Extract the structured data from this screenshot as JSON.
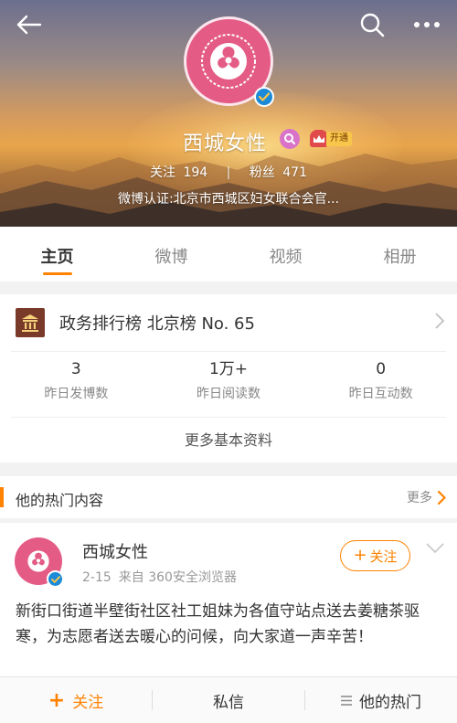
{
  "header": {
    "profile_name": "西城女性",
    "member_tag": "开通",
    "follow_label": "关注",
    "follow_count": "194",
    "fans_label": "粉丝",
    "fans_count": "471",
    "verification": "微博认证:北京市西城区妇女联合会官..."
  },
  "tabs": [
    {
      "label": "主页",
      "active": true
    },
    {
      "label": "微博",
      "active": false
    },
    {
      "label": "视频",
      "active": false
    },
    {
      "label": "相册",
      "active": false
    }
  ],
  "rank": {
    "text": "政务排行榜 北京榜 No. 65"
  },
  "metrics": [
    {
      "value": "3",
      "label": "昨日发博数"
    },
    {
      "value": "1万+",
      "label": "昨日阅读数"
    },
    {
      "value": "0",
      "label": "昨日互动数"
    }
  ],
  "more_info_label": "更多基本资料",
  "hot": {
    "title": "他的热门内容",
    "more_label": "更多"
  },
  "post": {
    "author": "西城女性",
    "date": "2-15",
    "source": "来自 360安全浏览器",
    "follow_label": "关注",
    "text": "新街口街道半壁街社区社工姐妹为各值守站点送去姜糖茶驱寒，为志愿者送去暖心的问候，向大家道一声辛苦！"
  },
  "bottom_bar": {
    "follow_label": "关注",
    "message_label": "私信",
    "hot_label": "他的热门"
  },
  "colors": {
    "accent": "#ff8200",
    "verified": "#1b8ad8",
    "avatar": "#e45b86"
  },
  "icons": [
    "back-arrow-icon",
    "search-icon",
    "more-icon",
    "verified-icon",
    "vip-icon",
    "crown-icon",
    "government-building-icon",
    "chevron-right-icon",
    "chevron-down-icon",
    "plus-icon",
    "menu-icon"
  ]
}
